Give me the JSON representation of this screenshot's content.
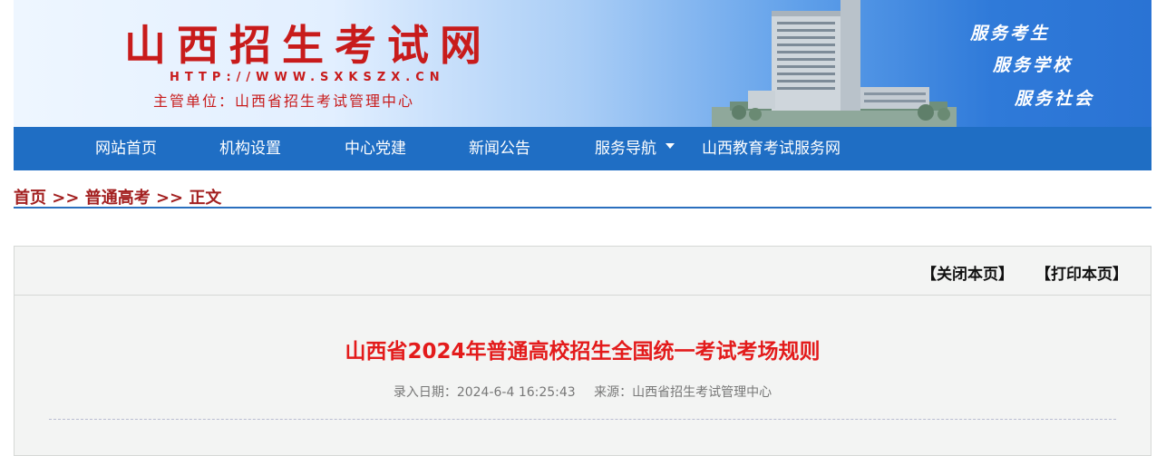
{
  "header": {
    "title": "山西招生考试网",
    "url": "HTTP://WWW.SXKSZX.CN",
    "department": "主管单位：山西省招生考试管理中心",
    "slogans": [
      "服务考生",
      "服务学校",
      "服务社会"
    ]
  },
  "nav": {
    "items": [
      "网站首页",
      "机构设置",
      "中心党建",
      "新闻公告",
      "服务导航",
      "山西教育考试服务网"
    ]
  },
  "breadcrumb": "首页 >> 普通高考 >> 正文",
  "article": {
    "close_label": "【关闭本页】",
    "print_label": "【打印本页】",
    "title": "山西省2024年普通高校招生全国统一考试考场规则",
    "date_text": "录入日期：2024-6-4 16:25:43",
    "source_text": "来源：山西省招生考试管理中心"
  },
  "colors": {
    "brand_red": "#c81b1b",
    "nav_blue": "#1f6ec4",
    "title_red": "#e31b1b"
  }
}
